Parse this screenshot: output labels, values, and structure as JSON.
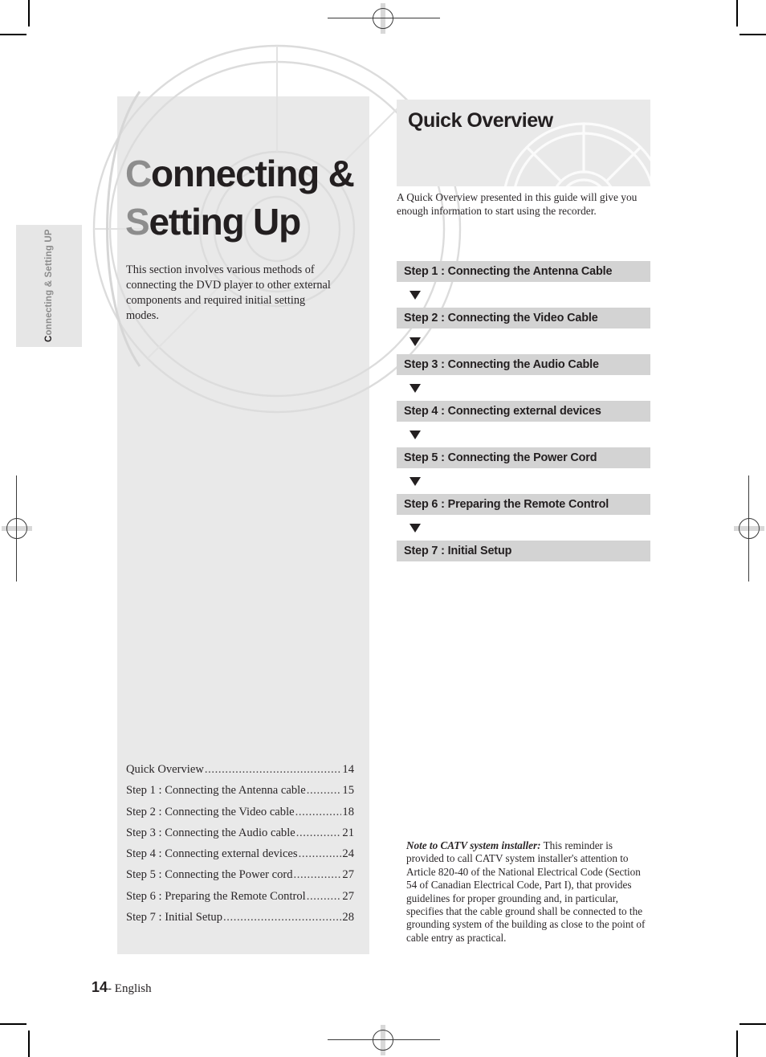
{
  "side_tab": {
    "lead_letter": "C",
    "rest": "onnecting & Setting UP",
    "full": "Connecting & Setting UP"
  },
  "chapter": {
    "title_line1_cap": "C",
    "title_line1_rest": "onnecting &",
    "title_line2_cap": "S",
    "title_line2_rest": "etting Up",
    "intro": "This section involves various methods of connecting the DVD player to other external components and required initial setting modes."
  },
  "toc": {
    "entries": [
      {
        "label": "Quick Overview",
        "page": "14"
      },
      {
        "label": "Step 1 : Connecting the Antenna cable",
        "page": "15"
      },
      {
        "label": "Step 2 : Connecting the Video cable",
        "page": "18"
      },
      {
        "label": "Step 3 : Connecting the Audio cable",
        "page": "21"
      },
      {
        "label": "Step 4 : Connecting external devices",
        "page": "24"
      },
      {
        "label": "Step 5 : Connecting the Power cord",
        "page": "27"
      },
      {
        "label": "Step 6 : Preparing the Remote Control",
        "page": "27"
      },
      {
        "label": "Step 7 : Initial Setup",
        "page": "28"
      }
    ],
    "leader": "......................................................................................."
  },
  "quick_overview": {
    "heading": "Quick Overview",
    "body": "A Quick Overview presented in this guide will give you enough information to start using the recorder.",
    "steps": [
      "Step 1 : Connecting the Antenna Cable",
      "Step 2 : Connecting the Video Cable",
      "Step 3 : Connecting the Audio Cable",
      "Step 4 : Connecting external devices",
      "Step 5 : Connecting the Power Cord",
      "Step 6 : Preparing the Remote Control",
      "Step 7 : Initial Setup"
    ]
  },
  "catv_note": {
    "lead": "Note to CATV system installer:",
    "body": " This reminder is provided to call CATV system installer's attention to Article 820-40 of the National Electrical Code (Section 54 of Canadian Electrical Code, Part I), that provides guidelines for proper grounding and, in particular, specifies that the cable ground shall be connected to the grounding system of the building as close to the point of cable entry as practical."
  },
  "footer": {
    "page_number": "14",
    "language": "- English"
  },
  "colors": {
    "panel_gray": "#e9e9e9",
    "step_bar_gray": "#d3d3d3",
    "title_accent_gray": "#8d8d8d",
    "ink": "#231f20"
  }
}
